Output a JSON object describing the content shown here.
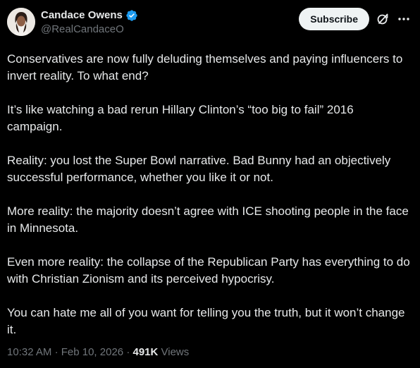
{
  "author": {
    "name": "Candace Owens",
    "handle": "@RealCandaceO"
  },
  "header": {
    "subscribe_label": "Subscribe"
  },
  "icons": {
    "verified": "verified-badge-icon",
    "grok": "grok-icon",
    "more": "more-icon",
    "verified_color": "#1d9bf0"
  },
  "post": {
    "paragraphs": [
      "Conservatives are now fully deluding themselves and paying influencers to invert reality. To what end?",
      "It’s like watching a bad rerun Hillary Clinton’s “too big to fail” 2016 campaign.",
      "Reality: you lost the Super Bowl narrative. Bad Bunny had an objectively successful performance, whether you like it or not.",
      "More reality: the majority doesn’t agree with ICE shooting people in the face in Minnesota.",
      "Even more reality: the collapse of the Republican Party has everything to do with Christian Zionism and its perceived hypocrisy.",
      "You can hate me all of you want for telling you the truth, but it won’t change it."
    ]
  },
  "meta": {
    "time": "10:32 AM",
    "separator": "·",
    "date": "Feb 10, 2026",
    "views_count": "491K",
    "views_label": "Views"
  }
}
